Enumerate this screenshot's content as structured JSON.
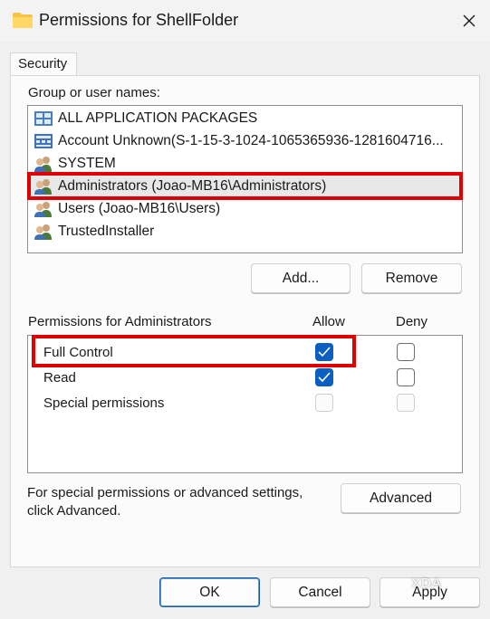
{
  "window": {
    "title": "Permissions for ShellFolder"
  },
  "tabs": [
    {
      "label": "Security"
    }
  ],
  "group_label": "Group or user names:",
  "principals": [
    {
      "name": "ALL APPLICATION PACKAGES",
      "icon": "packages-icon"
    },
    {
      "name": "Account Unknown(S-1-15-3-1024-1065365936-1281604716...",
      "icon": "unknown-account-icon"
    },
    {
      "name": "SYSTEM",
      "icon": "users-icon"
    },
    {
      "name": "Administrators (Joao-MB16\\Administrators)",
      "icon": "users-icon",
      "selected": true
    },
    {
      "name": "Users (Joao-MB16\\Users)",
      "icon": "users-icon"
    },
    {
      "name": "TrustedInstaller",
      "icon": "users-icon"
    }
  ],
  "buttons": {
    "add": "Add...",
    "remove": "Remove",
    "advanced": "Advanced",
    "ok": "OK",
    "cancel": "Cancel",
    "apply": "Apply"
  },
  "permissions": {
    "header": "Permissions for Administrators",
    "allow_label": "Allow",
    "deny_label": "Deny",
    "rows": [
      {
        "label": "Full Control",
        "allow": "checked",
        "deny": "unchecked"
      },
      {
        "label": "Read",
        "allow": "checked",
        "deny": "unchecked"
      },
      {
        "label": "Special permissions",
        "allow": "disabled",
        "deny": "disabled"
      }
    ]
  },
  "advanced_note": {
    "line1": "For special permissions or advanced settings,",
    "line2": "click Advanced."
  },
  "watermark": "XDA",
  "colors": {
    "highlight": "#e00000",
    "checkbox_on": "#0a5fc0",
    "ok_border": "#1a5ea8"
  }
}
